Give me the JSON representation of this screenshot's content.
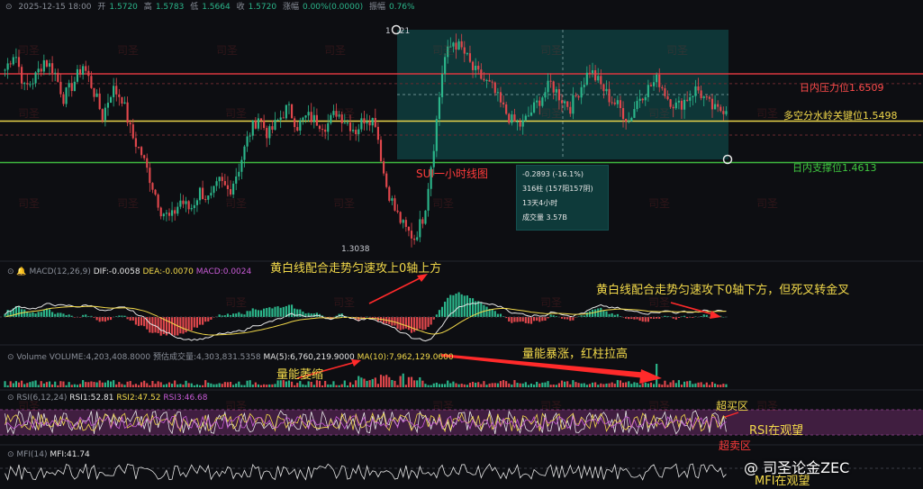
{
  "header": {
    "date": "2025-12-15 18:00",
    "open_label": "开",
    "open": "1.5720",
    "high_label": "高",
    "high": "1.5783",
    "low_label": "低",
    "low": "1.5664",
    "close_label": "收",
    "close": "1.5720",
    "chg_label": "涨幅",
    "chg": "0.00%(0.0000)",
    "amp_label": "振幅",
    "amp": "0.76%"
  },
  "price": {
    "resistance_label": "日内压力位1.6509",
    "pivot_label": "多空分水岭关键位1.5498",
    "support_label": "日内支撑位1.4613",
    "chart_title": "SUI一小时线图",
    "high_marker": "1",
    "high_marker2": "21",
    "low_marker": "1.3038",
    "measure": {
      "line1": "-0.2893 (-16.1%)",
      "line2": "316柱 (157阳157阴)",
      "line3": "13天4小时",
      "line4": "成交量 3.57B"
    },
    "colors": {
      "resistance": "#d9363e",
      "pivot": "#e8d34a",
      "support": "#3fb83f",
      "up": "#2bb58a",
      "down": "#e0474c"
    }
  },
  "macd": {
    "label": "MACD(12,26,9)",
    "dif": "DIF:-0.0058",
    "dea": "DEA:-0.0070",
    "macd": "MACD:0.0024",
    "annotation1": "黄白线配合走势匀速攻上0轴上方",
    "annotation2": "黄白线配合走势匀速攻下0轴下方，但死叉转金叉"
  },
  "volume": {
    "label": "Volume",
    "vol": "VOLUME:4,203,408.8000",
    "pred": "预估成交量:4,303,831.5358",
    "ma5": "MA(5):6,760,219.9000",
    "ma10": "MA(10):7,962,129.0600",
    "annotation1": "量能萎缩",
    "annotation2": "量能暴涨，红柱拉高"
  },
  "rsi": {
    "label": "RSI(6,12,24)",
    "rsi1": "RSI1:52.81",
    "rsi2": "RSI2:47.52",
    "rsi3": "RSI3:46.68",
    "overbought": "超买区",
    "watch": "RSI在观望",
    "oversold": "超卖区"
  },
  "mfi": {
    "label": "MFI(14)",
    "value": "MFI:41.74",
    "watch": "MFI在观望"
  },
  "watermark": {
    "text": "司圣",
    "brand": "@ 司圣论金ZEC"
  },
  "chart_data": {
    "type": "line",
    "title": "SUI一小时线图",
    "series": [
      {
        "name": "",
        "values": [
          1.66,
          1.7,
          1.62,
          1.64,
          1.68,
          1.66,
          1.6,
          1.63,
          1.67,
          1.62,
          1.56,
          1.62,
          1.6,
          1.52,
          1.48,
          1.42,
          1.36,
          1.34,
          1.38,
          1.36,
          1.4,
          1.38,
          1.42,
          1.4,
          1.45,
          1.52,
          1.56,
          1.52,
          1.55,
          1.58,
          1.54,
          1.56,
          1.55,
          1.54,
          1.57,
          1.55,
          1.53,
          1.56,
          1.55,
          1.42,
          1.36,
          1.32,
          1.3,
          1.35,
          1.5,
          1.68,
          1.72,
          1.7,
          1.66,
          1.64,
          1.62,
          1.58,
          1.55,
          1.54,
          1.57,
          1.6,
          1.63,
          1.6,
          1.58,
          1.62,
          1.66,
          1.63,
          1.6,
          1.58,
          1.55,
          1.6,
          1.62,
          1.64,
          1.6,
          1.58,
          1.6,
          1.62,
          1.59,
          1.57,
          1.58
        ]
      }
    ],
    "horizontal_lines": [
      {
        "label": "日内压力位1.6509",
        "value": 1.6509
      },
      {
        "label": "多空分水岭关键位1.5498",
        "value": 1.5498
      },
      {
        "label": "日内支撑位1.4613",
        "value": 1.4613
      }
    ],
    "xlabel": "",
    "ylabel": ""
  }
}
